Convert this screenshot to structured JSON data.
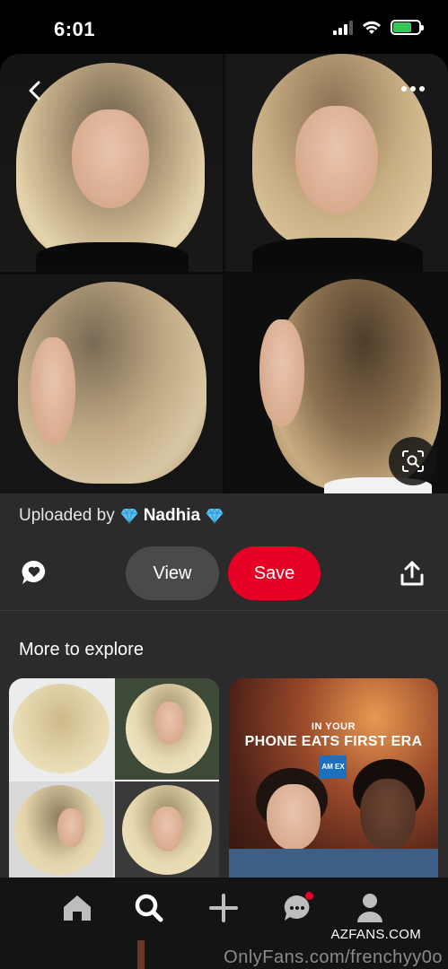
{
  "status_bar": {
    "time": "6:01",
    "battery_level": 0.7,
    "signal_bars": 4,
    "signal_active": 3
  },
  "pin": {
    "back_icon": "chevron-left-icon",
    "more_icon": "ellipsis-icon",
    "lens_icon": "visual-search-icon"
  },
  "details": {
    "uploaded_by_label": "Uploaded by",
    "uploader_name": "Nadhia",
    "view_label": "View",
    "save_label": "Save",
    "comment_icon": "comment-heart-icon",
    "share_icon": "share-icon"
  },
  "explore": {
    "title": "More to explore",
    "ad_line1": "IN YOUR",
    "ad_line2": "PHONE EATS FIRST ERA",
    "ad_logo_text": "AM EX"
  },
  "tabbar": {
    "tabs": [
      "home-icon",
      "search-icon",
      "plus-icon",
      "messages-icon",
      "profile-icon"
    ],
    "brand_text": "AZFANS.COM",
    "watermark": "OnlyFans.com/frenchyy0o"
  },
  "colors": {
    "save_red": "#e60023",
    "panel_bg": "#2b2b2b",
    "view_bg": "#4a4a4a"
  }
}
